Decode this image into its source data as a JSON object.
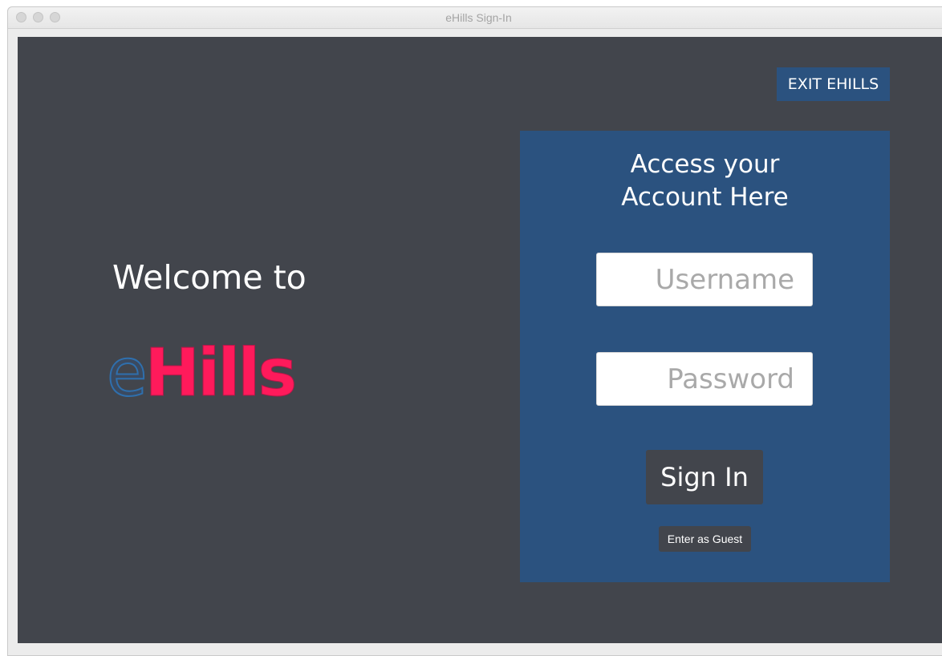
{
  "window": {
    "title": "eHills Sign-In"
  },
  "left": {
    "welcome": "Welcome to",
    "logo_first": "e",
    "logo_rest": "Hills"
  },
  "header": {
    "exit_label": "EXIT EHILLS"
  },
  "login": {
    "title_line1": "Access your",
    "title_line2": "Account Here",
    "username": {
      "value": "",
      "placeholder": "Username"
    },
    "password": {
      "value": "",
      "placeholder": "Password"
    },
    "signin_label": "Sign In",
    "guest_label": "Enter as Guest"
  },
  "colors": {
    "background": "#42454c",
    "panel": "#2b527f",
    "logo_e": "#2f6fad",
    "logo_hills": "#ff1a5b",
    "text": "#ffffff"
  },
  "icons": {
    "window_controls": [
      "close-icon",
      "minimize-icon",
      "zoom-icon"
    ]
  }
}
